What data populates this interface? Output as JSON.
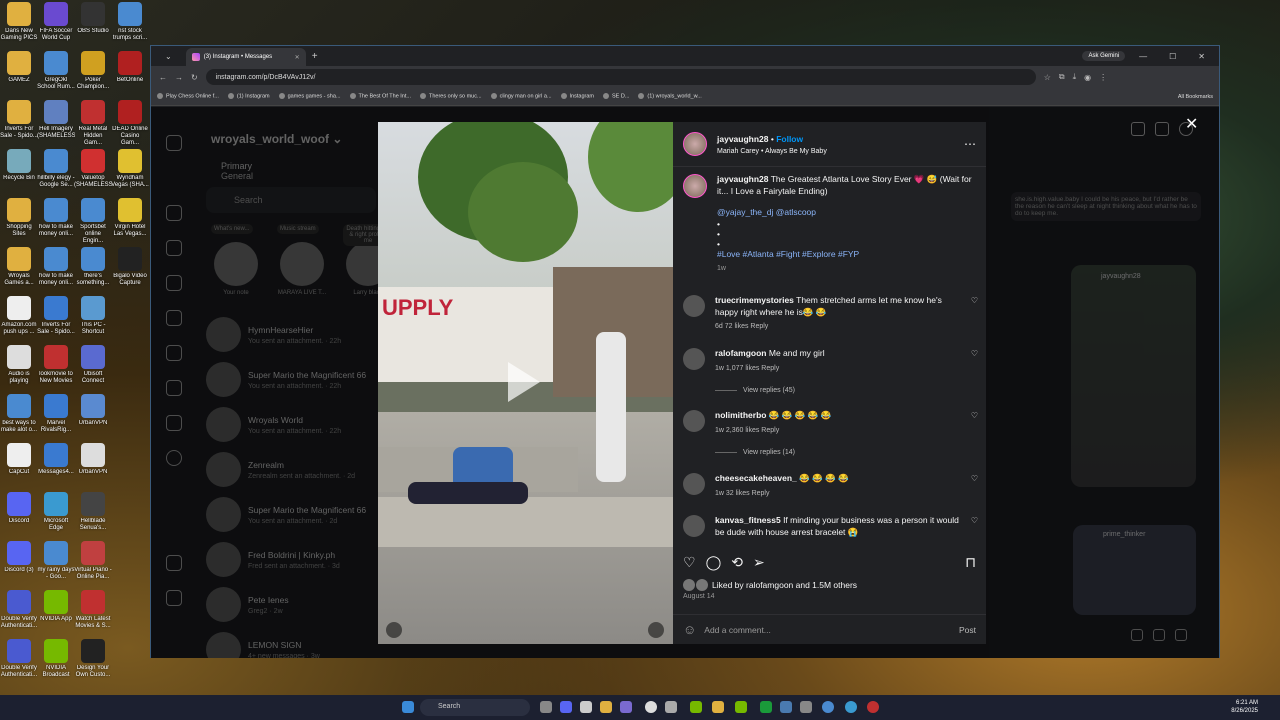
{
  "desktop": {
    "icons": [
      {
        "label": "Dans New Gaming PICS",
        "color": "#e0b040"
      },
      {
        "label": "FIFA Soccer World Cup",
        "color": "#6a4ad0"
      },
      {
        "label": "OBS Studio",
        "color": "#333"
      },
      {
        "label": "nst stock trumps scri...",
        "color": "#4a8ad0"
      },
      {
        "label": "GAMEZ",
        "color": "#e0b040"
      },
      {
        "label": "GregOkl School Rum...",
        "color": "#4a8ad0"
      },
      {
        "label": "Poker Champion...",
        "color": "#d0a020"
      },
      {
        "label": "BetOnline",
        "color": "#b02020"
      },
      {
        "label": "Inverts For Sale - Spido...",
        "color": "#e0b040"
      },
      {
        "label": "Hell Imagery (SHAMELESS)",
        "color": "#6080c0"
      },
      {
        "label": "Real Metal Hidden Gam...",
        "color": "#c03030"
      },
      {
        "label": "DEAD Online Casino Gam...",
        "color": "#b02020"
      },
      {
        "label": "Recycle Bin",
        "color": "#7ab"
      },
      {
        "label": "hillbilly elegy - Google Se...",
        "color": "#4a8ad0"
      },
      {
        "label": "Valuetop (SHAMELESS)",
        "color": "#d03030"
      },
      {
        "label": "Wyndham Vegas (SHA...",
        "color": "#e0c030"
      },
      {
        "label": "Shopping Sites",
        "color": "#e0b040"
      },
      {
        "label": "how to make money onli...",
        "color": "#4a8ad0"
      },
      {
        "label": "Sportsbet online Engin...",
        "color": "#4a8ad0"
      },
      {
        "label": "Virgin Hotel Las Vegas...",
        "color": "#e0c030"
      },
      {
        "label": "Wroyals Games a...",
        "color": "#e0b040"
      },
      {
        "label": "how to make money onli...",
        "color": "#4a8ad0"
      },
      {
        "label": "there's something...",
        "color": "#4a8ad0"
      },
      {
        "label": "Bigalo Video Capture",
        "color": "#222"
      },
      {
        "label": "Amazon.com push ups ...",
        "color": "#eee"
      },
      {
        "label": "Inverts For Sale - Spido...",
        "color": "#3a7ad0"
      },
      {
        "label": "This PC - Shortcut",
        "color": "#5a9ad0"
      },
      {
        "label": "",
        "color": "transparent"
      },
      {
        "label": "Audio is playing",
        "color": "#ddd"
      },
      {
        "label": "lookmovie to New Movies",
        "color": "#c03030"
      },
      {
        "label": "Ubisoft Connect",
        "color": "#5a6ad0"
      },
      {
        "label": "",
        "color": "transparent"
      },
      {
        "label": "best ways to make alot o...",
        "color": "#4a8ad0"
      },
      {
        "label": "Marvel RivalsRig...",
        "color": "#3a7ad0"
      },
      {
        "label": "UrbanVPN",
        "color": "#5a8ad0"
      },
      {
        "label": "",
        "color": "transparent"
      },
      {
        "label": "CapCut",
        "color": "#eee"
      },
      {
        "label": "Messages4...",
        "color": "#3a7ad0"
      },
      {
        "label": "UrbanVPN",
        "color": "#ddd"
      },
      {
        "label": "",
        "color": "transparent"
      },
      {
        "label": "Discord",
        "color": "#5865f2"
      },
      {
        "label": "Microsoft Edge",
        "color": "#3a9ad0"
      },
      {
        "label": "Hellblade Senua's...",
        "color": "#444"
      },
      {
        "label": "",
        "color": "transparent"
      },
      {
        "label": "Discord (3)",
        "color": "#5865f2"
      },
      {
        "label": "my rainy days - Goo...",
        "color": "#4a8ad0"
      },
      {
        "label": "Virtual Piano - Online Pia...",
        "color": "#c04040"
      },
      {
        "label": "",
        "color": "transparent"
      },
      {
        "label": "Double Verify Authenticati...",
        "color": "#4a5ad0"
      },
      {
        "label": "NVIDIA App",
        "color": "#76b900"
      },
      {
        "label": "Watch Latest Movies & S...",
        "color": "#c03030"
      },
      {
        "label": "",
        "color": "transparent"
      },
      {
        "label": "Double Verify Authenticati...",
        "color": "#4a5ad0"
      },
      {
        "label": "NVIDIA Broadcast",
        "color": "#76b900"
      },
      {
        "label": "Design Your Own Custo...",
        "color": "#222"
      },
      {
        "label": "",
        "color": "transparent"
      }
    ]
  },
  "browser": {
    "tab_title": "(3) Instagram • Messages",
    "gemini": "Ask Gemini",
    "url": "instagram.com/p/DcB4VAvJ12v/",
    "bookmarks": [
      "Play Chess Online f...",
      "(1) Instagram",
      "games games - sha...",
      "The Best Of The Int...",
      "Theres only so muc...",
      "clingy man on girl a...",
      "Instagram",
      "SE D...",
      "(1) wroyals_world_w..."
    ],
    "all_bookmarks": "All Bookmarks"
  },
  "dm": {
    "username": "wroyals_world_woof",
    "tabs": [
      "Primary",
      "General"
    ],
    "search_placeholder": "Search",
    "notes": [
      {
        "bubble": "What's new...",
        "name": "Your note"
      },
      {
        "bubble": "Music stream",
        "name": "MARAYA LIVE T..."
      },
      {
        "bubble": "Death hitting left & right protect me",
        "name": "Larry black"
      }
    ],
    "conversations": [
      {
        "name": "HymnHearseHier",
        "sub": "You sent an attachment. · 22h"
      },
      {
        "name": "Super Mario the Magnificent 66",
        "sub": "You sent an attachment. · 22h"
      },
      {
        "name": "Wroyals World",
        "sub": "You sent an attachment. · 22h"
      },
      {
        "name": "Zenrealm",
        "sub": "Zenrealm sent an attachment. · 2d"
      },
      {
        "name": "Super Mario the Magnificent 66",
        "sub": "You sent an attachment. · 2d"
      },
      {
        "name": "Fred Boldrini | Kinky.ph",
        "sub": "Fred sent an attachment. · 3d"
      },
      {
        "name": "Pete Ienes",
        "sub": "Greg2 · 2w"
      },
      {
        "name": "LEMON SIGN",
        "sub": "4+ new messages · 3w"
      }
    ]
  },
  "thread": {
    "message": "she.is.high.value.baby I could be his peace, but I'd rather be the reason he can't sleep at night thinking about what he has to do to keep me.",
    "thumb1_user": "jayvaughn28",
    "thumb2_user": "prime_thinker"
  },
  "post": {
    "store_sign": "UPPLY",
    "author": "jayvaughn28",
    "follow": "Follow",
    "song": "Mariah Carey • Always Be My Baby",
    "caption_text": "The Greatest Atlanta Love Story Ever 💗 😅 (Wait for it... I Love a Fairytale Ending)",
    "caption_mentions": "@yajay_the_dj @atlscoop",
    "caption_dots": "•\n•\n•",
    "caption_tags": "#Love #Atlanta #Fight #Explore #FYP",
    "caption_time": "1w",
    "comments": [
      {
        "user": "truecrimemystories",
        "text": "Them stretched arms let me know he's happy right where he is😂 😂",
        "meta": "6d   72 likes   Reply",
        "replies": ""
      },
      {
        "user": "ralofamgoon",
        "text": "Me and my girl",
        "meta": "1w   1,077 likes   Reply",
        "replies": "View replies (45)"
      },
      {
        "user": "nolimitherbo",
        "text": "😂 😂 😂 😂 😂",
        "meta": "1w   2,360 likes   Reply",
        "replies": "View replies (14)"
      },
      {
        "user": "cheesecakeheaven_",
        "text": "😂 😂 😂 😂",
        "meta": "1w   32 likes   Reply",
        "replies": ""
      },
      {
        "user": "kanvas_fitness5",
        "text": "If minding your business was a person it would be dude with house arrest bracelet 😭",
        "meta": "",
        "replies": ""
      }
    ],
    "liked_by": "Liked by ralofamgoon and 1.5M others",
    "date": "August 14",
    "add_comment_placeholder": "Add a comment...",
    "post_label": "Post"
  },
  "taskbar": {
    "search": "Search",
    "time": "6:21 AM",
    "date": "8/26/2025"
  }
}
